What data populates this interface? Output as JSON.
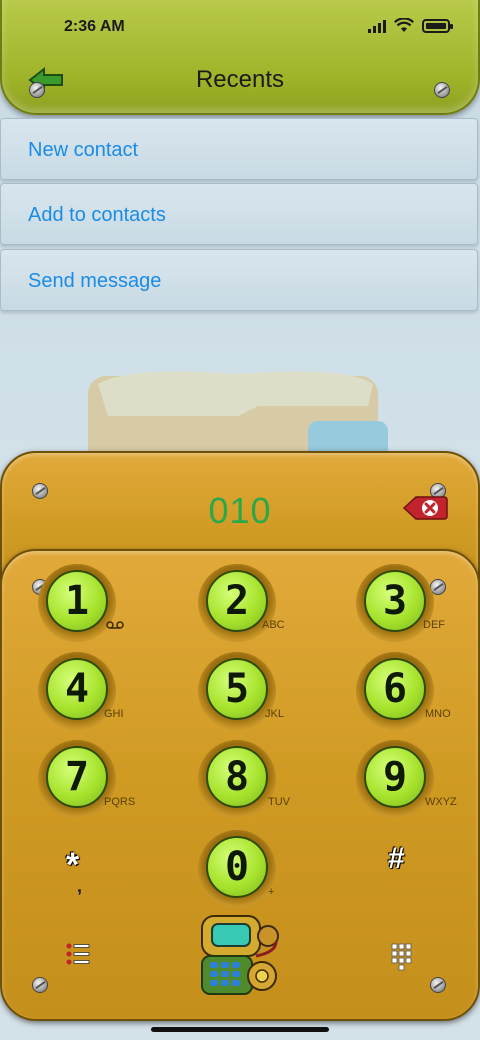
{
  "status_bar": {
    "time": "2:36 AM"
  },
  "header": {
    "title": "Recents"
  },
  "menu": [
    {
      "label": "New contact"
    },
    {
      "label": "Add to contacts"
    },
    {
      "label": "Send message"
    }
  ],
  "dialer": {
    "number": "010",
    "keys": [
      {
        "digit": "1",
        "letters": ""
      },
      {
        "digit": "2",
        "letters": "ABC"
      },
      {
        "digit": "3",
        "letters": "DEF"
      },
      {
        "digit": "4",
        "letters": "GHI"
      },
      {
        "digit": "5",
        "letters": "JKL"
      },
      {
        "digit": "6",
        "letters": "MNO"
      },
      {
        "digit": "7",
        "letters": "PQRS"
      },
      {
        "digit": "8",
        "letters": "TUV"
      },
      {
        "digit": "9",
        "letters": "WXYZ"
      },
      {
        "digit": "0",
        "letters": "+"
      }
    ],
    "star": {
      "symbol": "*",
      "sub": ","
    },
    "hash": {
      "symbol": "#"
    }
  },
  "colors": {
    "accent": "#1a8be6",
    "number": "#2aa84a",
    "header": "#9fb329",
    "panel": "#cf9a22"
  },
  "icons": [
    "back-arrow-icon",
    "voicemail-icon",
    "backspace-icon",
    "list-icon",
    "call-icon",
    "keypad-icon"
  ]
}
